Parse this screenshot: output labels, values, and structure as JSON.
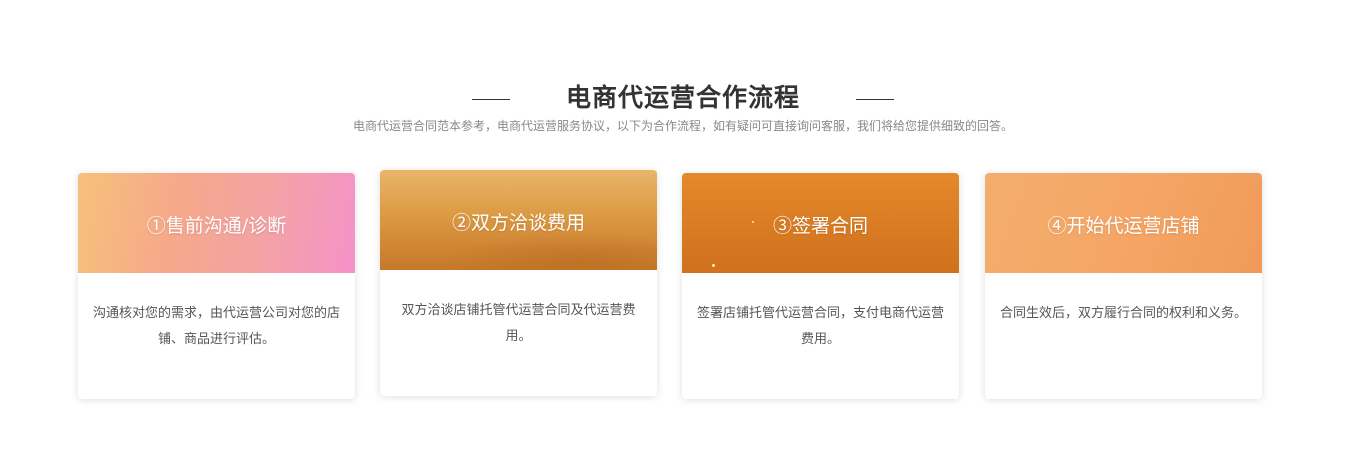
{
  "section": {
    "title": "电商代运营合作流程",
    "subtitle": "电商代运营合同范本参考，电商代运营服务协议，以下为合作流程，如有疑问可直接询问客服，我们将给您提供细致的回答。"
  },
  "steps": [
    {
      "title": "①售前沟通/诊断",
      "description": "沟通核对您的需求，由代运营公司对您的店铺、商品进行评估。"
    },
    {
      "title": "②双方洽谈费用",
      "description": "双方洽谈店铺托管代运营合同及代运营费用。"
    },
    {
      "title": "③签署合同",
      "description": "签署店铺托管代运营合同，支付电商代运营费用。"
    },
    {
      "title": "④开始代运营店铺",
      "description": "合同生效后，双方履行合同的权利和义务。"
    }
  ]
}
